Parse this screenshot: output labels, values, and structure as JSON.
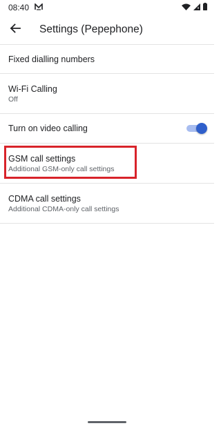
{
  "status_bar": {
    "time": "08:40",
    "icons": [
      "notification-m-icon",
      "wifi-icon",
      "cell-signal-icon",
      "battery-icon"
    ]
  },
  "app_bar": {
    "back_icon": "back-arrow-icon",
    "title": "Settings (Pepephone)"
  },
  "settings": {
    "fixed_dialling": {
      "title": "Fixed dialling numbers"
    },
    "wifi_calling": {
      "title": "Wi-Fi Calling",
      "summary": "Off"
    },
    "video_calling": {
      "title": "Turn on video calling",
      "toggle_on": true
    },
    "gsm": {
      "title": "GSM call settings",
      "summary": "Additional GSM-only call settings"
    },
    "cdma": {
      "title": "CDMA call settings",
      "summary": "Additional CDMA-only call settings"
    }
  },
  "colors": {
    "accent": "#2f5fcb",
    "toggle_track": "#a8bdf0",
    "highlight": "#d8232a",
    "divider": "#e3e3e3"
  }
}
